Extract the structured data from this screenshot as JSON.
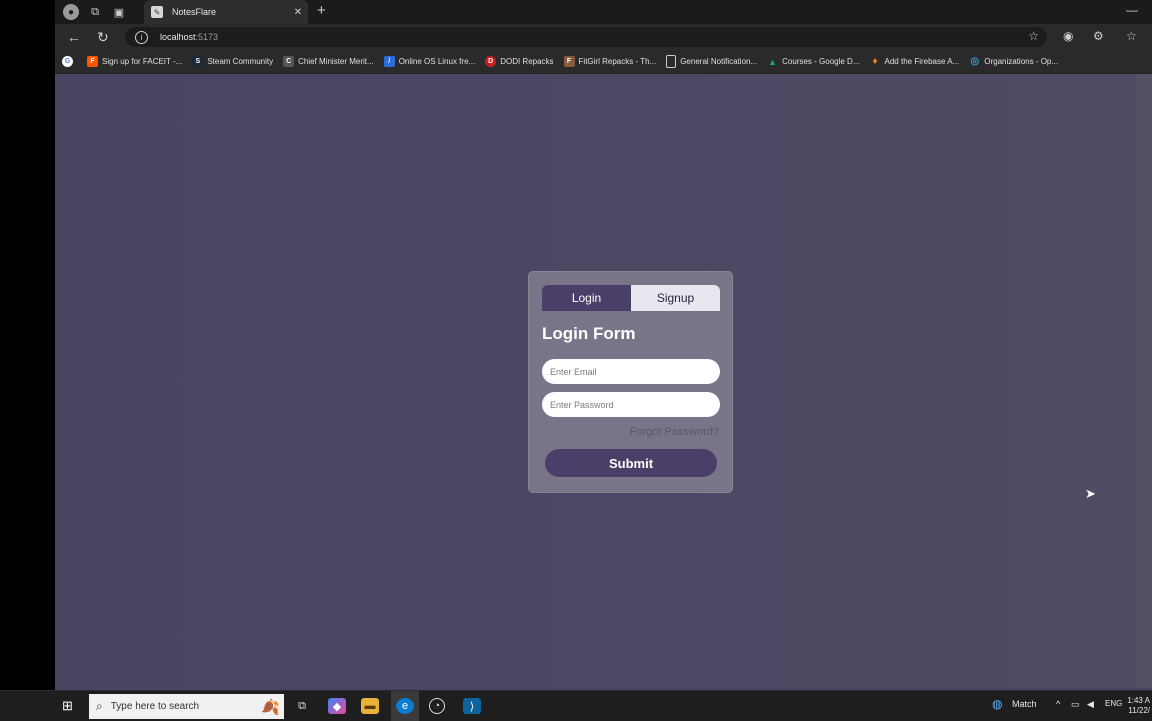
{
  "browser": {
    "tab_title": "NotesFlare",
    "tab_close": "✕",
    "new_tab": "+",
    "minimize": "—",
    "url_host": "localhost",
    "url_port": ":5173"
  },
  "bookmarks": [
    {
      "label": "Sign up for FACEIT -...",
      "icon": "faceit-icon",
      "color": "#ff5500",
      "glyph": "F"
    },
    {
      "label": "Steam Community",
      "icon": "steam-icon",
      "color": "#1b2838",
      "glyph": "S"
    },
    {
      "label": "Chief Minister Merit...",
      "icon": "cm-icon",
      "color": "#555555",
      "glyph": "C"
    },
    {
      "label": "Online OS Linux fre...",
      "icon": "linux-icon",
      "color": "#2d6cdf",
      "glyph": "/"
    },
    {
      "label": "DODI Repacks",
      "icon": "dodi-icon",
      "color": "#c81e1e",
      "glyph": "D"
    },
    {
      "label": "FitGirl Repacks - Th...",
      "icon": "fitgirl-icon",
      "color": "#8a5a3c",
      "glyph": "F"
    },
    {
      "label": "General Notification...",
      "icon": "page-icon",
      "color": "#6a6a6a",
      "glyph": "▢"
    },
    {
      "label": "Courses - Google D...",
      "icon": "drive-icon",
      "color": "#1fa463",
      "glyph": "▲"
    },
    {
      "label": "Add the Firebase A...",
      "icon": "firebase-icon",
      "color": "#f5820d",
      "glyph": "♦"
    },
    {
      "label": "Organizations - Op...",
      "icon": "org-icon",
      "color": "#3aa0d8",
      "glyph": "◎"
    }
  ],
  "login": {
    "tab_login": "Login",
    "tab_signup": "Signup",
    "title": "Login Form",
    "email_placeholder": "Enter Email",
    "password_placeholder": "Enter Password",
    "forgot": "Forgot Password?",
    "submit": "Submit"
  },
  "taskbar": {
    "search_placeholder": "Type here to search",
    "weather": "Match",
    "lang": "ENG",
    "time": "1:43 A",
    "date": "11/22/"
  },
  "colors": {
    "page_bg": "#4a4463",
    "card_bg": "#7a7489",
    "accent": "#4a3f68"
  }
}
